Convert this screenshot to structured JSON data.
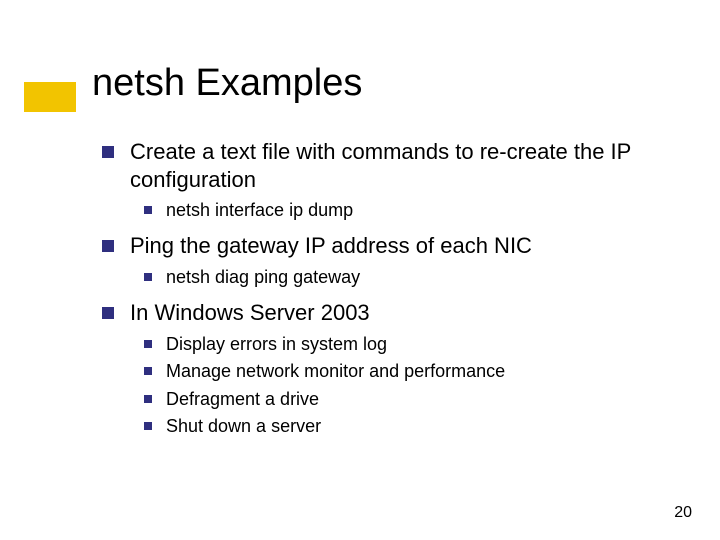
{
  "title": "netsh Examples",
  "page_number": "20",
  "bullets": [
    {
      "text": "Create a text file with commands to re-create the IP configuration",
      "sub": [
        "netsh interface ip dump"
      ]
    },
    {
      "text": "Ping the gateway IP address of each NIC",
      "sub": [
        "netsh diag ping gateway"
      ]
    },
    {
      "text": "In Windows Server 2003",
      "sub": [
        "Display errors in system log",
        "Manage network monitor and performance",
        "Defragment a drive",
        "Shut down a server"
      ]
    }
  ]
}
